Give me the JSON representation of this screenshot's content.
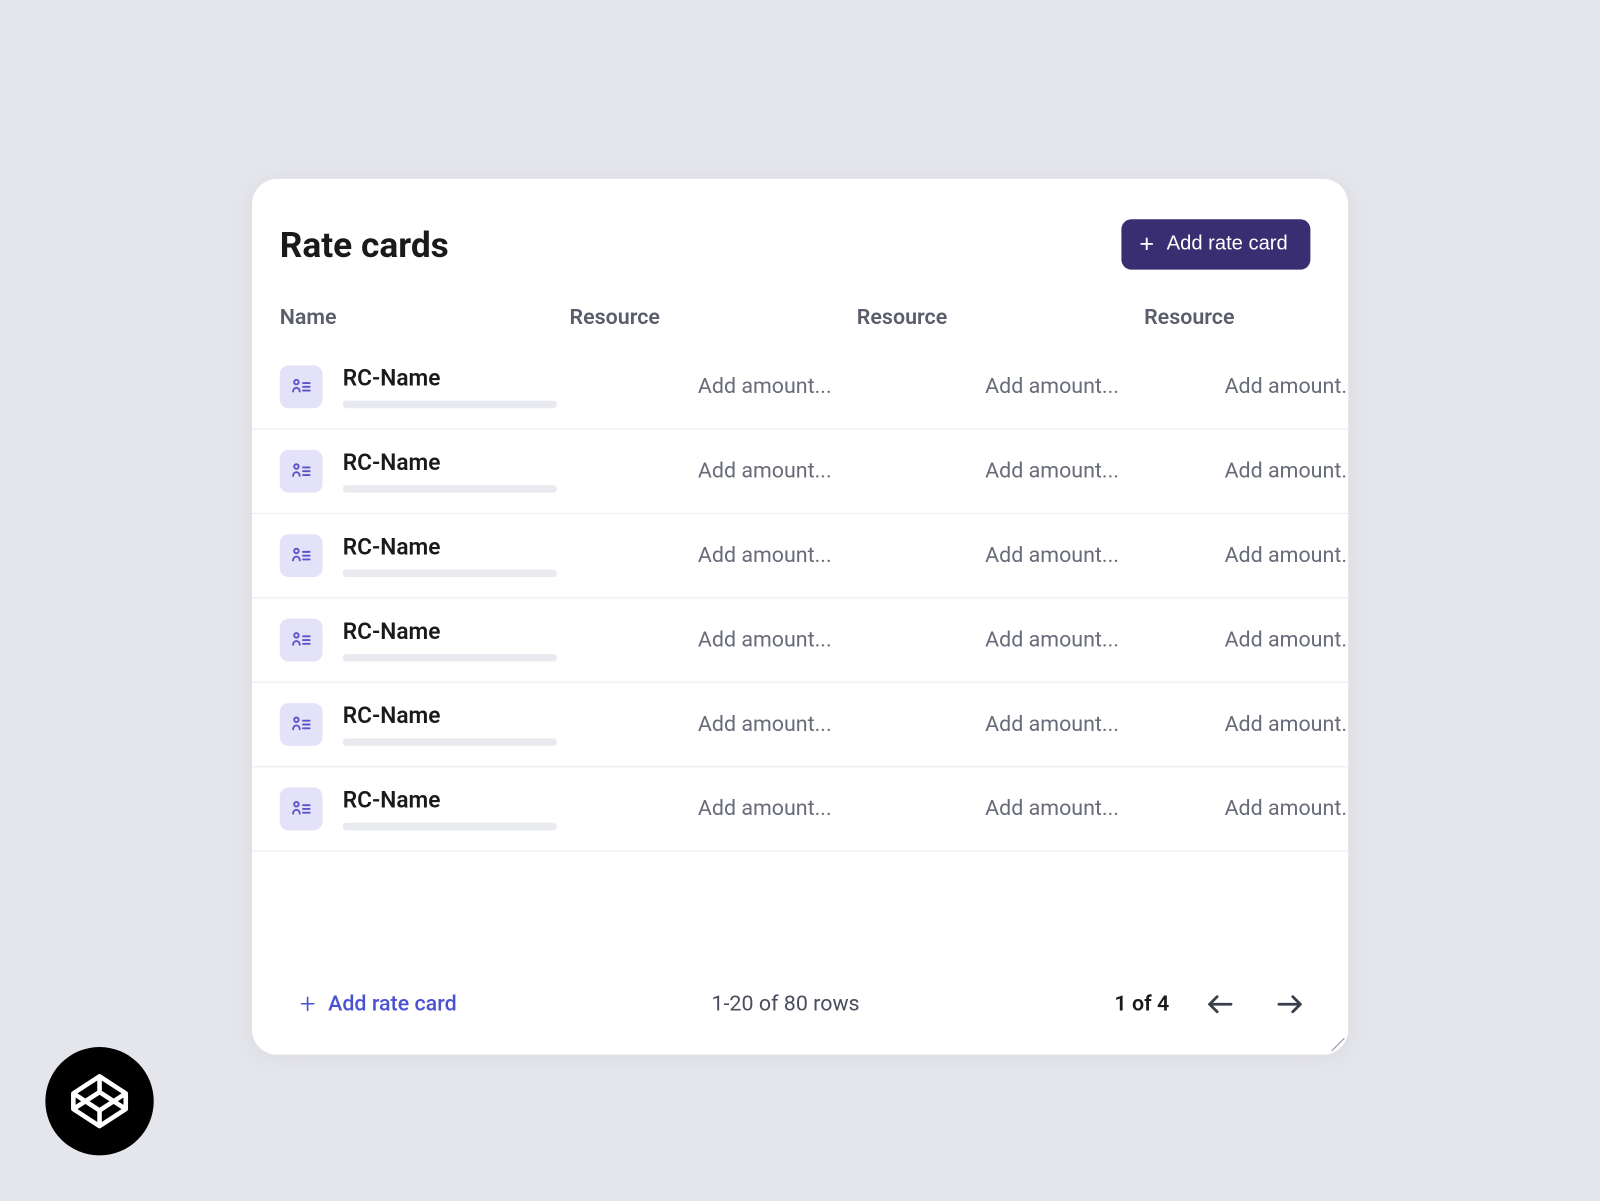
{
  "header": {
    "title": "Rate cards",
    "add_button_label": "Add rate card"
  },
  "columns": {
    "name": "Name",
    "res1": "Resource",
    "res2": "Resource",
    "res3": "Resource"
  },
  "rows": [
    {
      "name": "RC-Name",
      "amount1": "Add amount...",
      "amount2": "Add amount...",
      "amount3": "Add amount..."
    },
    {
      "name": "RC-Name",
      "amount1": "Add amount...",
      "amount2": "Add amount...",
      "amount3": "Add amount..."
    },
    {
      "name": "RC-Name",
      "amount1": "Add amount...",
      "amount2": "Add amount...",
      "amount3": "Add amount..."
    },
    {
      "name": "RC-Name",
      "amount1": "Add amount...",
      "amount2": "Add amount...",
      "amount3": "Add amount..."
    },
    {
      "name": "RC-Name",
      "amount1": "Add amount...",
      "amount2": "Add amount...",
      "amount3": "Add amount..."
    },
    {
      "name": "RC-Name",
      "amount1": "Add amount...",
      "amount2": "Add amount...",
      "amount3": "Add amount..."
    }
  ],
  "footer": {
    "add_link_label": "Add rate card",
    "rows_text": "1-20 of 80 rows",
    "page_text": "1 of 4"
  }
}
